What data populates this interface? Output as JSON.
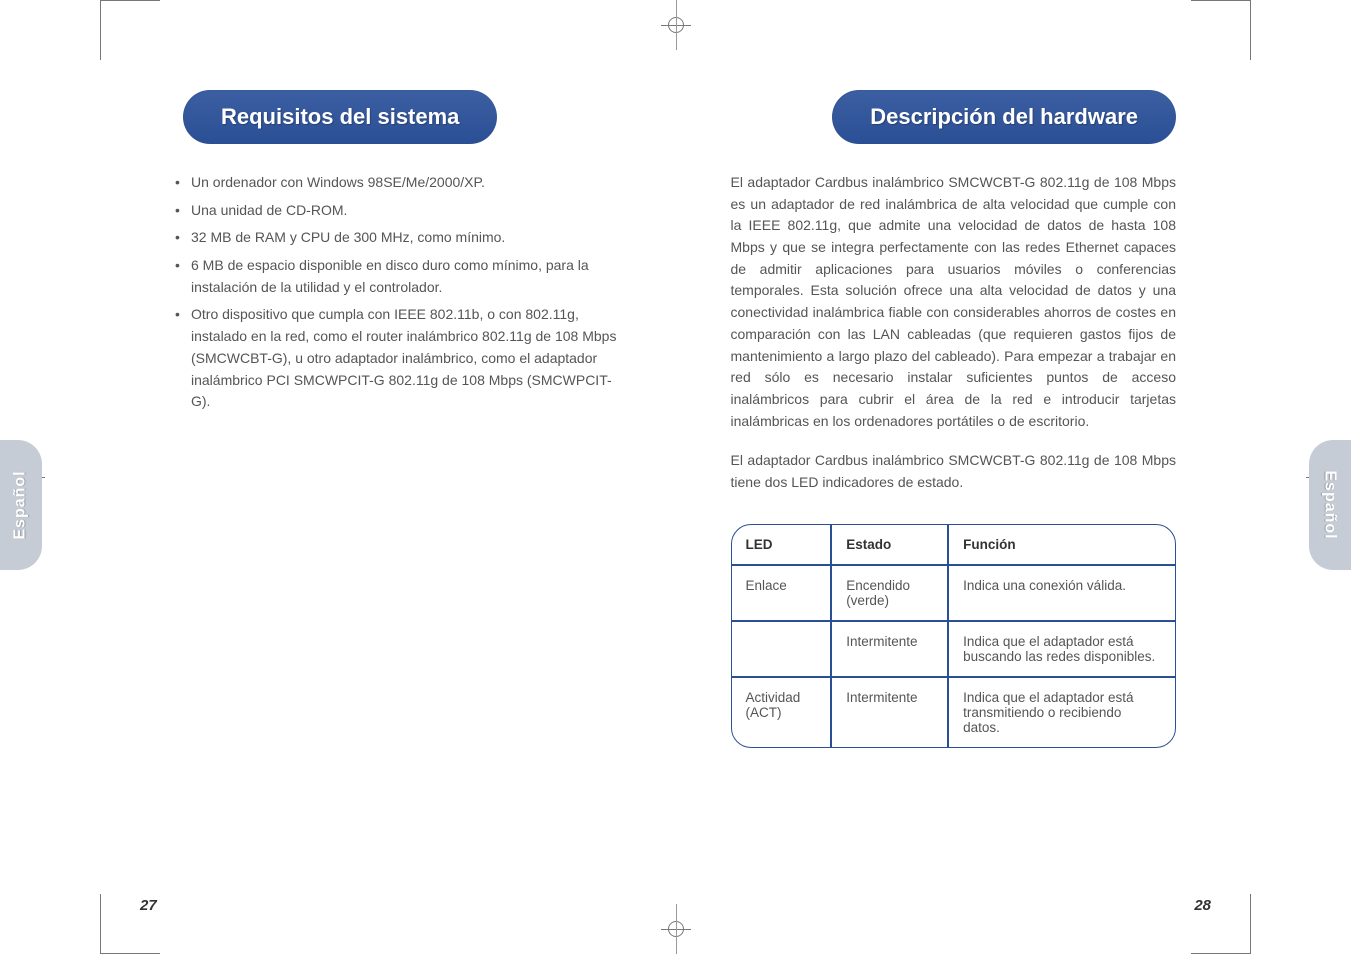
{
  "language_tab": "Español",
  "left": {
    "heading": "Requisitos del sistema",
    "bullets": [
      "Un ordenador con Windows 98SE/Me/2000/XP.",
      "Una unidad de CD-ROM.",
      "32 MB de RAM y CPU de 300 MHz, como mínimo.",
      "6 MB de espacio disponible en disco duro como mínimo, para la instalación de la utilidad y el controlador.",
      "Otro dispositivo que cumpla con IEEE 802.11b, o con 802.11g, instalado en la red, como el router inalámbrico 802.11g de 108 Mbps (SMCWCBT-G), u otro adaptador inalámbrico, como el adaptador inalámbrico PCI SMCWPCIT-G 802.11g de 108 Mbps (SMCWPCIT-G)."
    ],
    "page_num": "27"
  },
  "right": {
    "heading": "Descripción del hardware",
    "para1": "El adaptador Cardbus inalámbrico SMCWCBT-G 802.11g de 108 Mbps es un adaptador de red inalámbrica de alta velocidad que cumple con la IEEE 802.11g, que admite una velocidad de datos de hasta 108 Mbps y que se integra perfectamente con las redes Ethernet capaces de admitir aplicaciones para usuarios móviles o conferencias temporales. Esta solución ofrece una alta velocidad de datos y una conectividad inalámbrica fiable con considerables ahorros de costes en comparación con las LAN cableadas (que requieren gastos fijos de mantenimiento a largo plazo del cableado). Para empezar a trabajar en red sólo es necesario instalar suficientes puntos de acceso inalámbricos para cubrir el área de la red e introducir tarjetas inalámbricas en los ordenadores portátiles o de escritorio.",
    "para2": "El adaptador Cardbus inalámbrico SMCWCBT-G 802.11g de 108 Mbps tiene dos LED indicadores de estado.",
    "table": {
      "headers": {
        "c1": "LED",
        "c2": "Estado",
        "c3": "Función"
      },
      "rows": [
        {
          "led": "Enlace",
          "estado": "Encendido (verde)",
          "funcion": "Indica una conexión válida."
        },
        {
          "led": "",
          "estado": "Intermitente",
          "funcion": "Indica que el adaptador está buscando las redes disponibles."
        },
        {
          "led": "Actividad (ACT)",
          "estado": "Intermitente",
          "funcion": "Indica que el adaptador está transmitiendo o recibiendo datos."
        }
      ]
    },
    "page_num": "28"
  }
}
